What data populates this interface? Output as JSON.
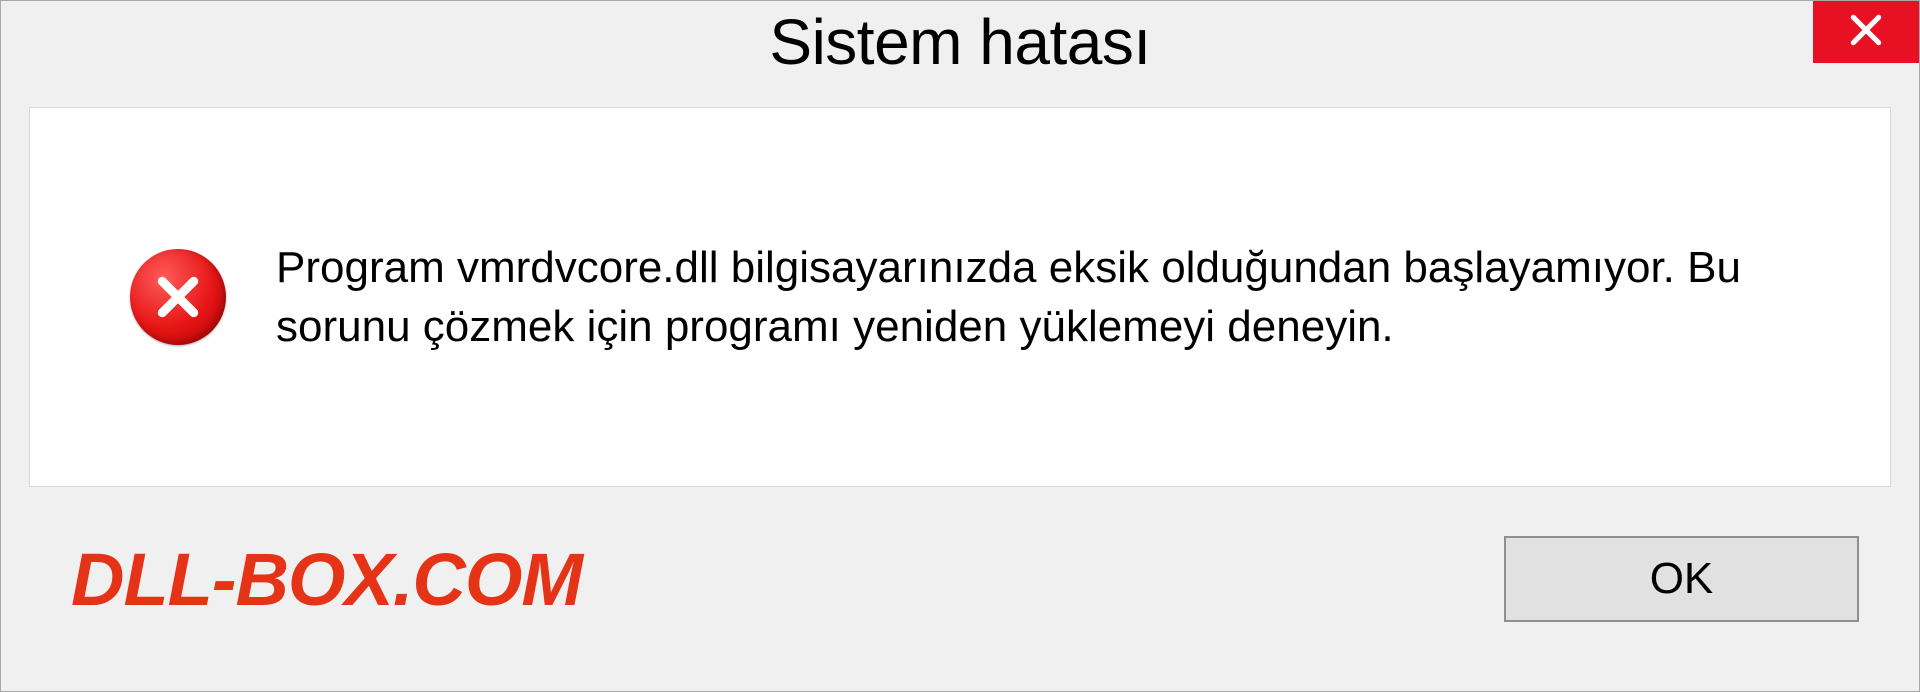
{
  "dialog": {
    "title": "Sistem hatası",
    "message": "Program vmrdvcore.dll bilgisayarınızda eksik olduğundan başlayamıyor. Bu sorunu çözmek için programı yeniden yüklemeyi deneyin.",
    "ok_label": "OK"
  },
  "watermark": {
    "text": "DLL-BOX.COM"
  },
  "colors": {
    "close_button_bg": "#e81123",
    "error_icon_red": "#d40000",
    "watermark_red": "#e53317",
    "dialog_bg": "#f0f0f0",
    "content_bg": "#ffffff"
  }
}
